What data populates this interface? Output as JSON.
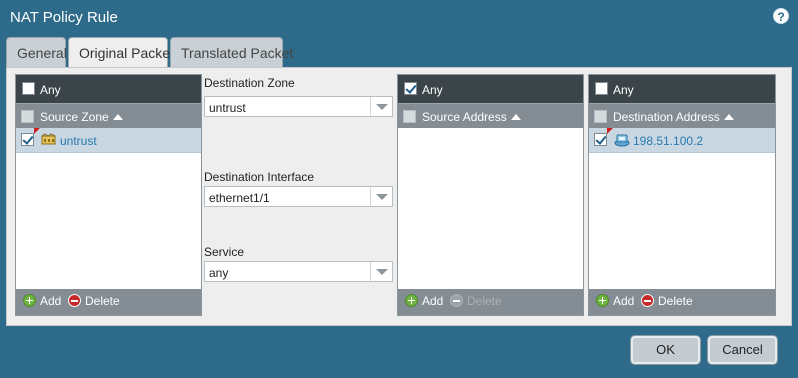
{
  "window": {
    "title": "NAT Policy Rule",
    "help_icon": "?"
  },
  "tabs": [
    {
      "label": "General"
    },
    {
      "label": "Original Packet"
    },
    {
      "label": "Translated Packet"
    }
  ],
  "source_zone_panel": {
    "any_label": "Any",
    "any_checked": false,
    "column_header": "Source Zone",
    "rows": [
      {
        "label": "untrust",
        "checked": true
      }
    ],
    "add_label": "Add",
    "delete_label": "Delete"
  },
  "middle": {
    "destination_zone": {
      "label": "Destination Zone",
      "value": "untrust"
    },
    "destination_interface": {
      "label": "Destination Interface",
      "value": "ethernet1/1"
    },
    "service": {
      "label": "Service",
      "value": "any"
    }
  },
  "source_address_panel": {
    "any_label": "Any",
    "any_checked": true,
    "column_header": "Source Address",
    "rows": [],
    "add_label": "Add",
    "delete_label": "Delete"
  },
  "destination_address_panel": {
    "any_label": "Any",
    "any_checked": false,
    "column_header": "Destination Address",
    "rows": [
      {
        "label": "198.51.100.2",
        "checked": true
      }
    ],
    "add_label": "Add",
    "delete_label": "Delete"
  },
  "footer": {
    "ok_label": "OK",
    "cancel_label": "Cancel"
  },
  "colors": {
    "window_bg": "#2e6b8a",
    "panel_header": "#3b4449",
    "column_header": "#838d93",
    "selected_row": "#c8d7e2",
    "link_text": "#2a7ab0",
    "add_green": "#6cb33f",
    "delete_red": "#c62828"
  }
}
